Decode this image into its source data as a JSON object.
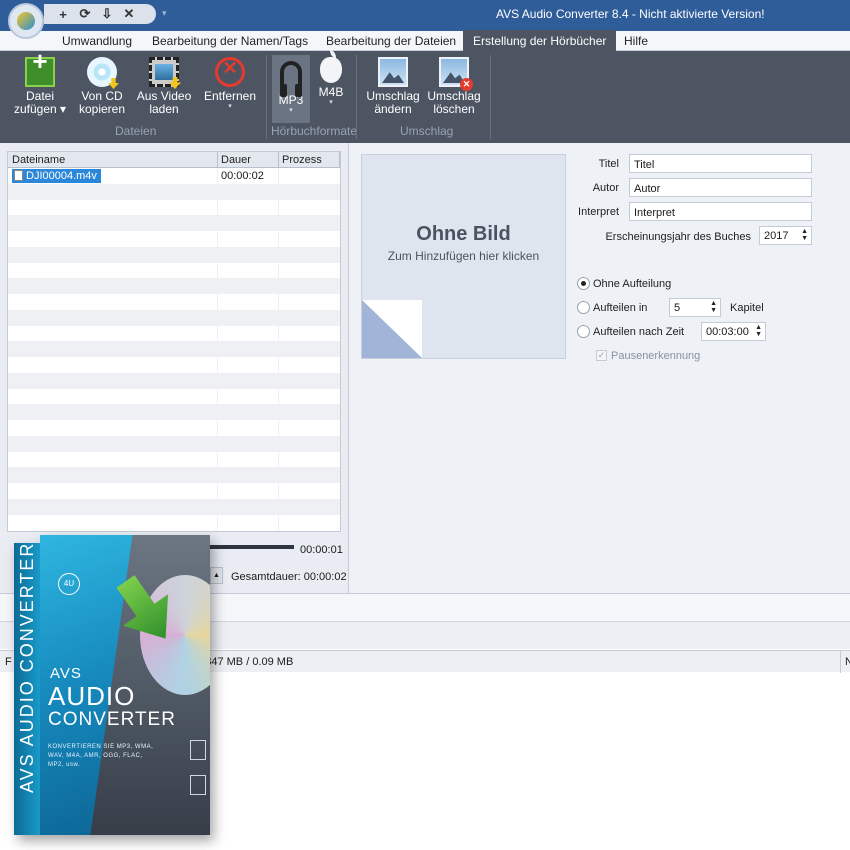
{
  "window": {
    "title": "AVS Audio Converter  8.4 - Nicht aktivierte Version!",
    "quick_access": [
      "+",
      "⟳",
      "⇩",
      "✕"
    ],
    "qat_more": "▾"
  },
  "menu": {
    "tabs": [
      "Umwandlung",
      "Bearbeitung der Namen/Tags",
      "Bearbeitung der Dateien",
      "Erstellung der Hörbücher",
      "Hilfe"
    ],
    "active_index": 3
  },
  "ribbon": {
    "groups": {
      "dateien": "Dateien",
      "formate": "Hörbuchformate",
      "umschlag": "Umschlag"
    },
    "buttons": {
      "datei_zufuegen_line1": "Datei",
      "datei_zufuegen_line2": "zufügen ▾",
      "von_cd_line1": "Von CD",
      "von_cd_line2": "kopieren",
      "aus_video_line1": "Aus Video",
      "aus_video_line2": "laden",
      "entfernen": "Entfernen",
      "mp3": "MP3",
      "m4b": "M4B",
      "umschlag_aendern_line1": "Umschlag",
      "umschlag_aendern_line2": "ändern",
      "umschlag_loeschen_line1": "Umschlag",
      "umschlag_loeschen_line2": "löschen",
      "dropdown_glyph": "▾"
    },
    "icons": [
      "add-file-icon",
      "cd-icon",
      "film-icon",
      "remove-icon",
      "headphones-icon",
      "apple-icon",
      "picture-icon",
      "picture-delete-icon"
    ]
  },
  "file_list": {
    "columns": [
      "Dateiname",
      "Dauer",
      "Prozess"
    ],
    "rows": [
      {
        "name": "DJI00004.m4v",
        "duration": "00:00:02",
        "progress": ""
      }
    ]
  },
  "player": {
    "current_time": "00:00:01",
    "total_label": "Gesamtdauer:",
    "total_time": "00:00:02",
    "volume_up_glyph": "▲",
    "volume_glyph": "))"
  },
  "cover": {
    "title": "Ohne Bild",
    "subtitle": "Zum Hinzufügen hier klicken"
  },
  "book_fields": {
    "titel_label": "Titel",
    "titel_value": "Titel",
    "autor_label": "Autor",
    "autor_value": "Autor",
    "interpret_label": "Interpret",
    "interpret_value": "Interpret",
    "year_label": "Erscheinungsjahr des Buches",
    "year_value": "2017"
  },
  "split": {
    "option_none": "Ohne Aufteilung",
    "option_chapters": "Aufteilen in",
    "chapters_value": "5",
    "chapters_unit": "Kapitel",
    "option_time": "Aufteilen nach Zeit",
    "time_value": "00:03:00",
    "pause_detection": "Pausenerkennung",
    "selected": "none",
    "spin_glyph": "▲\n▼"
  },
  "status": {
    "left": "F",
    "size": "09847 MB / 0.09 MB",
    "right": "N"
  },
  "product_box": {
    "logo": "4U",
    "brand": "AVS",
    "audio": "AUDIO",
    "converter": "CONVERTER",
    "description": "KONVERTIEREN SIE MP3, WMA, WAV, M4A, AMR, OGG, FLAC, MP2, usw.",
    "spine": "AVS   AUDIO CONVERTER"
  },
  "colors": {
    "titlebar": "#2f5d9a",
    "ribbon": "#4d5563",
    "selection": "#2b87d9",
    "box_blue": "#1689bd"
  }
}
